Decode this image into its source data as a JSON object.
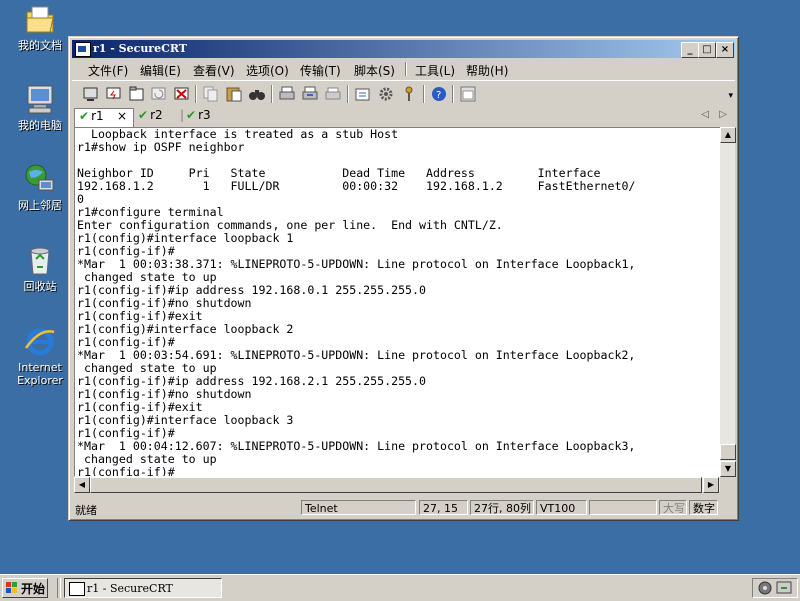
{
  "desktop": {
    "icons": [
      {
        "label": "我的文档",
        "icon": "my-documents-icon"
      },
      {
        "label": "我的电脑",
        "icon": "my-computer-icon"
      },
      {
        "label": "网上邻居",
        "icon": "network-icon"
      },
      {
        "label": "回收站",
        "icon": "recycle-bin-icon"
      },
      {
        "label": "Internet Explorer",
        "icon": "internet-explorer-icon"
      }
    ]
  },
  "window": {
    "title": "r1 - SecureCRT",
    "menu": [
      "文件(F)",
      "编辑(E)",
      "查看(V)",
      "选项(O)",
      "传输(T)",
      "脚本(S)",
      "工具(L)",
      "帮助(H)"
    ],
    "tabs": [
      {
        "label": "r1",
        "close": "×"
      },
      {
        "label": "r2"
      },
      {
        "label": "r3"
      }
    ],
    "terminal_lines": [
      "  Loopback interface is treated as a stub Host",
      "r1#show ip OSPF neighbor",
      "",
      "Neighbor ID     Pri   State           Dead Time   Address         Interface",
      "192.168.1.2       1   FULL/DR         00:00:32    192.168.1.2     FastEthernet0/",
      "0",
      "r1#configure terminal",
      "Enter configuration commands, one per line.  End with CNTL/Z.",
      "r1(config)#interface loopback 1",
      "r1(config-if)#",
      "*Mar  1 00:03:38.371: %LINEPROTO-5-UPDOWN: Line protocol on Interface Loopback1,",
      " changed state to up",
      "r1(config-if)#ip address 192.168.0.1 255.255.255.0",
      "r1(config-if)#no shutdown",
      "r1(config-if)#exit",
      "r1(config)#interface loopback 2",
      "r1(config-if)#",
      "*Mar  1 00:03:54.691: %LINEPROTO-5-UPDOWN: Line protocol on Interface Loopback2,",
      " changed state to up",
      "r1(config-if)#ip address 192.168.2.1 255.255.255.0",
      "r1(config-if)#no shutdown",
      "r1(config-if)#exit",
      "r1(config)#interface loopback 3",
      "r1(config-if)#",
      "*Mar  1 00:04:12.607: %LINEPROTO-5-UPDOWN: Line protocol on Interface Loopback3,",
      " changed state to up",
      "r1(config-if)#"
    ],
    "status": {
      "ready": "就绪",
      "protocol": "Telnet",
      "cursor": "27, 15",
      "size": "27行, 80列",
      "emulation": "VT100",
      "caps": "大写",
      "num": "数字"
    }
  },
  "taskbar": {
    "start_label": "开始",
    "task_label": "r1 - SecureCRT"
  }
}
